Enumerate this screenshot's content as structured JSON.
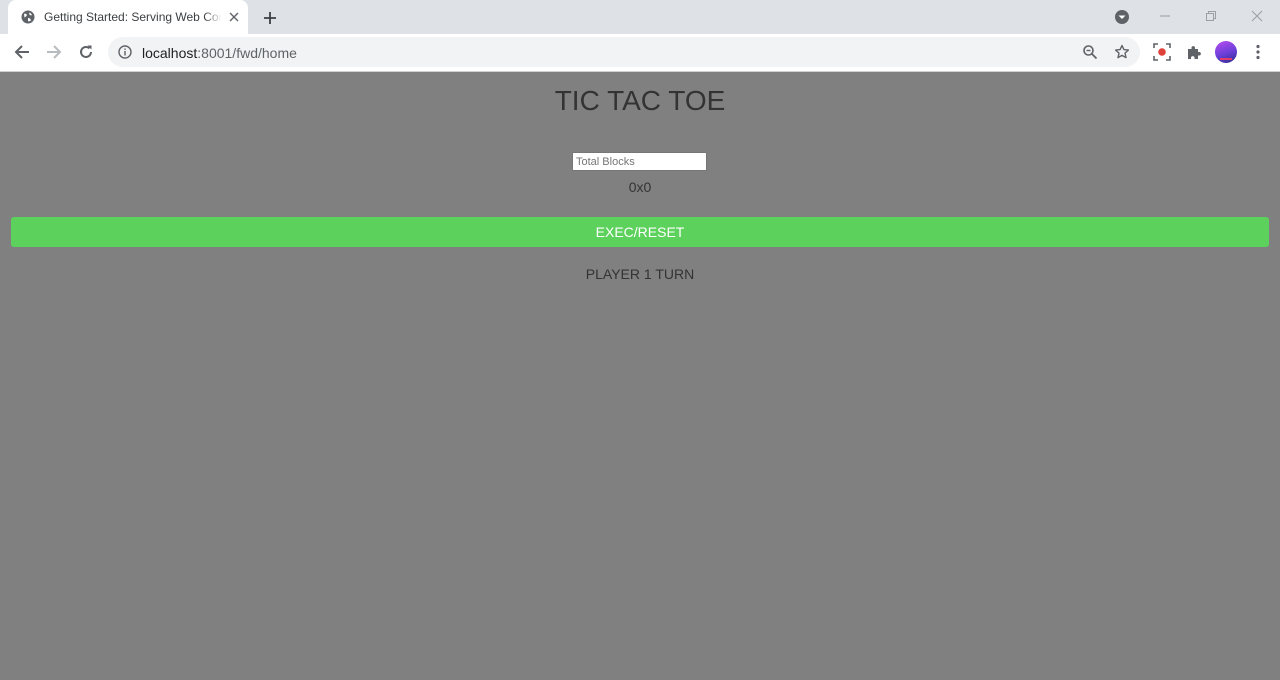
{
  "browser": {
    "tab": {
      "title": "Getting Started: Serving Web Content"
    },
    "url": {
      "host": "localhost",
      "path": ":8001/fwd/home"
    },
    "icons": [
      "globe-icon",
      "close-icon",
      "plus-icon",
      "profile-chevron-icon",
      "minimize-icon",
      "restore-icon",
      "window-close-icon",
      "back-arrow-icon",
      "forward-arrow-icon",
      "reload-icon",
      "info-icon",
      "zoom-icon",
      "star-icon",
      "screen-record-icon",
      "puzzle-icon",
      "more-vert-icon"
    ]
  },
  "page": {
    "title": "TIC TAC TOE",
    "blocks_input": {
      "placeholder": "Total Blocks",
      "value": ""
    },
    "board_size": "0x0",
    "exec_button": "EXEC/RESET",
    "turn_status": "PLAYER 1 TURN"
  },
  "colors": {
    "page_background": "#808080",
    "button_green": "#5cd15c",
    "text": "#333333"
  }
}
